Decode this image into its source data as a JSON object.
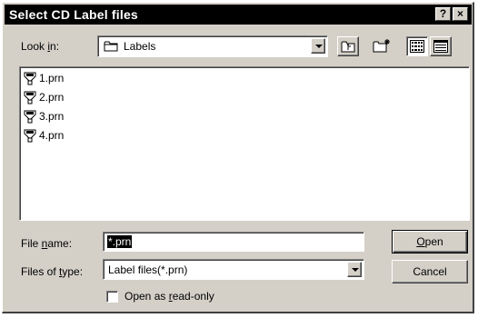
{
  "dialog": {
    "title": "Select CD Label files",
    "help_button": "?",
    "close_button": "×"
  },
  "look_in": {
    "label_pre": "Look ",
    "label_accel": "i",
    "label_post": "n:",
    "value": "Labels"
  },
  "files": [
    {
      "name": "1.prn",
      "icon": "printer-file-icon"
    },
    {
      "name": "2.prn",
      "icon": "printer-file-icon"
    },
    {
      "name": "3.prn",
      "icon": "printer-file-icon"
    },
    {
      "name": "4.prn",
      "icon": "printer-file-icon"
    }
  ],
  "file_name": {
    "label_pre": "File ",
    "label_accel": "n",
    "label_post": "ame:",
    "value": "*.prn"
  },
  "files_of_type": {
    "label_pre": "Files of ",
    "label_accel": "t",
    "label_post": "ype:",
    "value": "Label files(*.prn)"
  },
  "buttons": {
    "open_accel": "O",
    "open_rest": "pen",
    "cancel": "Cancel"
  },
  "read_only": {
    "label_pre": "Open as ",
    "label_accel": "r",
    "label_post": "ead-only",
    "checked": false
  }
}
